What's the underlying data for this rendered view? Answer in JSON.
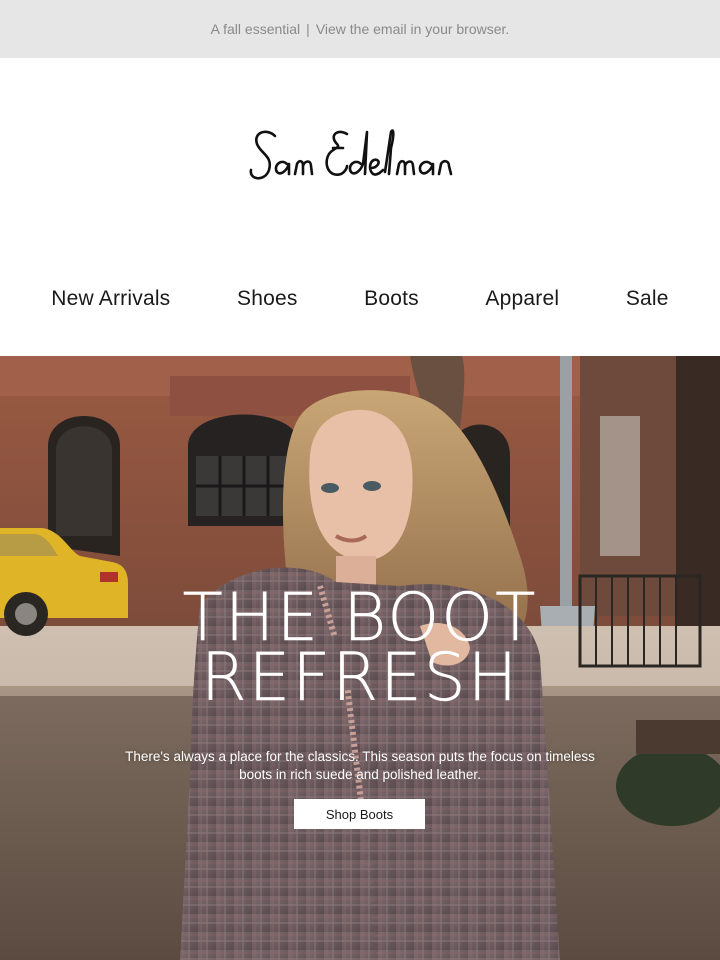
{
  "preheader": {
    "tagline": "A fall essential",
    "separator": "|",
    "browser_link": "View the email in your browser."
  },
  "logo": {
    "text": "Sam Edelman"
  },
  "nav": {
    "items": [
      {
        "label": "New Arrivals"
      },
      {
        "label": "Shoes"
      },
      {
        "label": "Boots"
      },
      {
        "label": "Apparel"
      },
      {
        "label": "Sale"
      }
    ]
  },
  "hero": {
    "title_line1": "THE BOOT",
    "title_line2": "REFRESH",
    "body": "There's always a place for the classics. This season puts the focus on timeless boots in rich suede and polished leather.",
    "cta_label": "Shop Boots"
  },
  "colors": {
    "preheader_bg": "#e6e6e6",
    "preheader_text": "#8a8a8a",
    "text": "#1a1a1a",
    "cta_bg": "#ffffff"
  }
}
